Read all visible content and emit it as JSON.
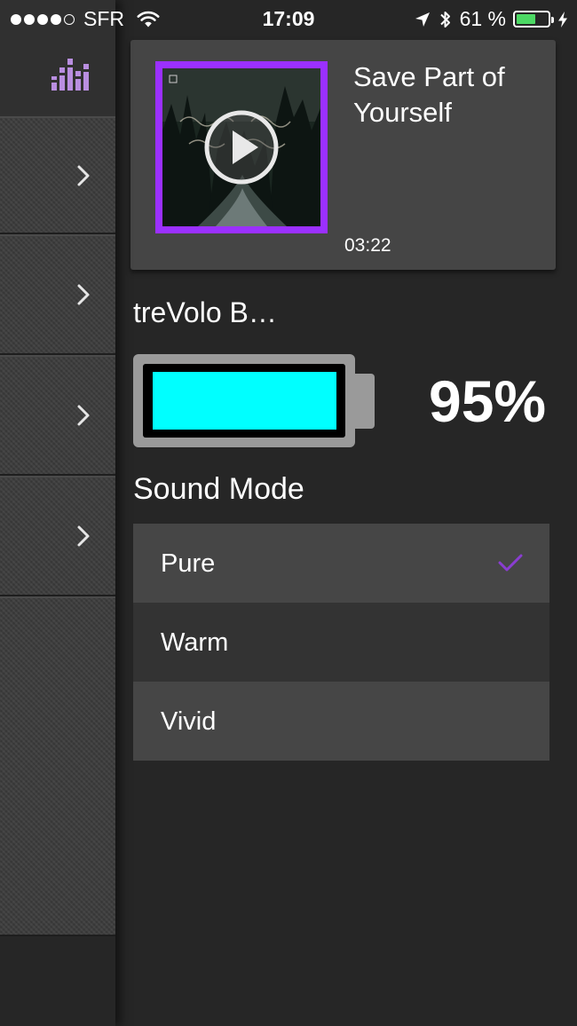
{
  "status_bar": {
    "carrier": "SFR",
    "time": "17:09",
    "battery_percent_text": "61 %",
    "battery_level": 0.61,
    "signal_bars_filled": 4,
    "signal_bars_total": 5,
    "icons": [
      "wifi-icon",
      "location-arrow-icon",
      "bluetooth-icon",
      "battery-icon",
      "charging-bolt-icon"
    ],
    "battery_color": "#4cd964"
  },
  "sidebar": {
    "header_icon": "equalizer-icon",
    "rows": [
      {
        "icon": "chevron-right-icon"
      },
      {
        "icon": "chevron-right-icon"
      },
      {
        "icon": "chevron-right-icon"
      },
      {
        "icon": "chevron-right-icon"
      }
    ],
    "accent_color": "#b98ee0"
  },
  "now_playing": {
    "title": "Save Part of Yourself",
    "time": "03:22",
    "play_icon": "play-icon",
    "album_border_color": "#9b30ff"
  },
  "device": {
    "name": "treVolo B…",
    "battery_percent_text": "95%",
    "battery_level": 0.95,
    "battery_fill_color": "#00ffff"
  },
  "sound_mode": {
    "title": "Sound Mode",
    "options": [
      {
        "label": "Pure",
        "selected": true
      },
      {
        "label": "Warm",
        "selected": false
      },
      {
        "label": "Vivid",
        "selected": false
      }
    ],
    "check_color": "#8a3dd1"
  }
}
